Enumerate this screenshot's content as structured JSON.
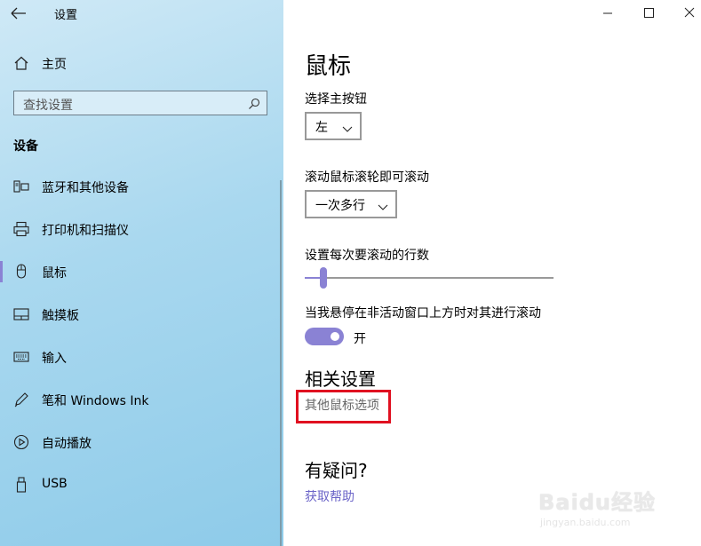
{
  "window": {
    "app_title": "设置"
  },
  "sidebar": {
    "home_label": "主页",
    "search_placeholder": "查找设置",
    "section_title": "设备",
    "items": [
      {
        "label": "蓝牙和其他设备",
        "icon": "bluetooth-devices-icon"
      },
      {
        "label": "打印机和扫描仪",
        "icon": "printer-icon"
      },
      {
        "label": "鼠标",
        "icon": "mouse-icon",
        "selected": true
      },
      {
        "label": "触摸板",
        "icon": "touchpad-icon"
      },
      {
        "label": "输入",
        "icon": "keyboard-icon"
      },
      {
        "label": "笔和 Windows Ink",
        "icon": "pen-icon"
      },
      {
        "label": "自动播放",
        "icon": "autoplay-icon"
      },
      {
        "label": "USB",
        "icon": "usb-icon"
      }
    ]
  },
  "content": {
    "page_title": "鼠标",
    "primary_button_label": "选择主按钮",
    "primary_button_value": "左",
    "scroll_mode_label": "滚动鼠标滚轮即可滚动",
    "scroll_mode_value": "一次多行",
    "lines_label": "设置每次要滚动的行数",
    "lines_slider_fraction": 0.04,
    "inactive_scroll_label": "当我悬停在非活动窗口上方时对其进行滚动",
    "inactive_scroll_state": "开",
    "related_title": "相关设置",
    "other_mouse_options": "其他鼠标选项",
    "question_title": "有疑问?",
    "get_help": "获取帮助"
  },
  "watermark": {
    "logo": "Baidu经验",
    "url": "jingyan.baidu.com"
  },
  "colors": {
    "accent": "#8a82d4",
    "highlight": "#e01020",
    "link": "#6b64c8"
  }
}
